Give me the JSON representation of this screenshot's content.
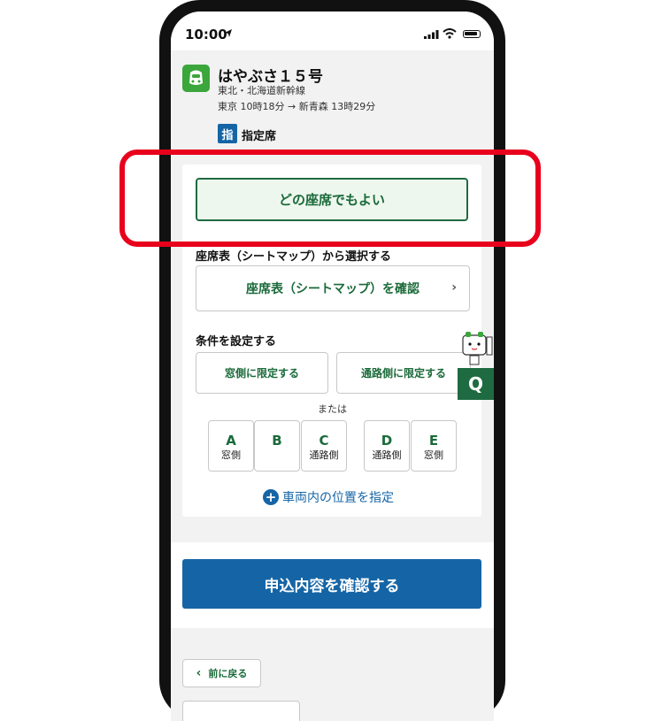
{
  "status_bar": {
    "time": "10:00"
  },
  "train": {
    "name": "はやぶさ１５号",
    "line": "東北・北海道新幹線",
    "schedule": "東京 10時18分 → 新青森 13時29分",
    "seat_type_badge": "指",
    "seat_type_label": "指定席"
  },
  "seat_options": {
    "any_seat_label": "どの座席でもよい",
    "seatmap_section_title": "座席表（シートマップ）から選択する",
    "seatmap_button_label": "座席表（シートマップ）を確認",
    "chevron": "›",
    "conditions_title": "条件を設定する",
    "window_only_label": "窓側に限定する",
    "aisle_only_label": "通路側に限定する",
    "or_label": "または",
    "seats": [
      {
        "letter": "A",
        "position": "窓側"
      },
      {
        "letter": "B",
        "position": ""
      },
      {
        "letter": "C",
        "position": "通路側"
      },
      {
        "letter": "D",
        "position": "通路側"
      },
      {
        "letter": "E",
        "position": "窓側"
      }
    ],
    "car_position_label": "車両内の位置を指定",
    "plus_symbol": "+"
  },
  "help": {
    "q_label": "Q"
  },
  "actions": {
    "confirm_label": "申込内容を確認する",
    "back_label": "前に戻る",
    "back_chevron": "‹"
  },
  "colors": {
    "accent_green": "#1f6b41",
    "primary_blue": "#1565a6",
    "highlight_red": "#e8001c",
    "train_icon_green": "#3aa63b"
  }
}
